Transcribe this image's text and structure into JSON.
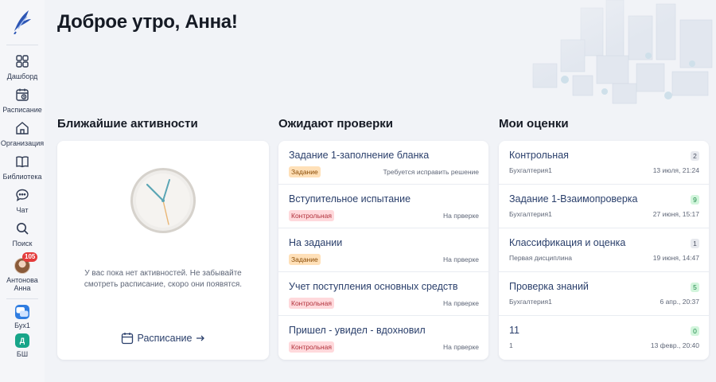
{
  "greeting": "Доброе утро, Анна!",
  "sidebar": {
    "items": [
      {
        "label": "Дашборд",
        "icon": "dashboard-icon"
      },
      {
        "label": "Расписание",
        "icon": "schedule-icon"
      },
      {
        "label": "Организация",
        "icon": "organization-icon"
      },
      {
        "label": "Библиотека",
        "icon": "library-icon"
      },
      {
        "label": "Чат",
        "icon": "chat-icon"
      },
      {
        "label": "Поиск",
        "icon": "search-icon"
      }
    ],
    "user": {
      "label": "Антонова Анна",
      "badge": "105"
    },
    "orgs": [
      {
        "label": "Бух1",
        "chip": "",
        "color": "#2f7de1"
      },
      {
        "label": "БШ",
        "chip": "Д",
        "color": "#17a589"
      }
    ]
  },
  "activities": {
    "title": "Ближайшие активности",
    "empty_text": "У вас пока нет активностей. Не забывайте смотреть расписание, скоро они появятся.",
    "link": "Расписание"
  },
  "review": {
    "title": "Ожидают проверки",
    "items": [
      {
        "title": "Задание 1-заполнение бланка",
        "tag": "Задание",
        "status": "Требуется исправить решение"
      },
      {
        "title": "Вступительное испытание",
        "tag": "Контрольная",
        "status": "На прверке"
      },
      {
        "title": "На задании",
        "tag": "Задание",
        "status": "На прверке"
      },
      {
        "title": "Учет поступления основных средств",
        "tag": "Контрольная",
        "status": "На прверке"
      },
      {
        "title": "Пришел - увидел - вдохновил",
        "tag": "Контрольная",
        "status": "На прверке"
      }
    ]
  },
  "grades": {
    "title": "Мои оценки",
    "items": [
      {
        "title": "Контрольная",
        "course": "Бухгалтерия1",
        "date": "13 июля, 21:24",
        "grade": "2",
        "color": "gray"
      },
      {
        "title": "Задание 1-Взаимопроверка",
        "course": "Бухгалтерия1",
        "date": "27 июня, 15:17",
        "grade": "9",
        "color": "green"
      },
      {
        "title": "Классификация и оценка",
        "course": "Первая дисциплина",
        "date": "19 июня, 14:47",
        "grade": "1",
        "color": "gray"
      },
      {
        "title": "Проверка знаний",
        "course": "Бухгалтерия1",
        "date": "6 апр., 20:37",
        "grade": "5",
        "color": "green"
      },
      {
        "title": "11",
        "course": "1",
        "date": "13 февр., 20:40",
        "grade": "0",
        "color": "green"
      }
    ]
  },
  "colors": {
    "accent": "#2a3f6b",
    "task_tag": "#ffe0b8",
    "control_tag": "#ffd9dc"
  }
}
